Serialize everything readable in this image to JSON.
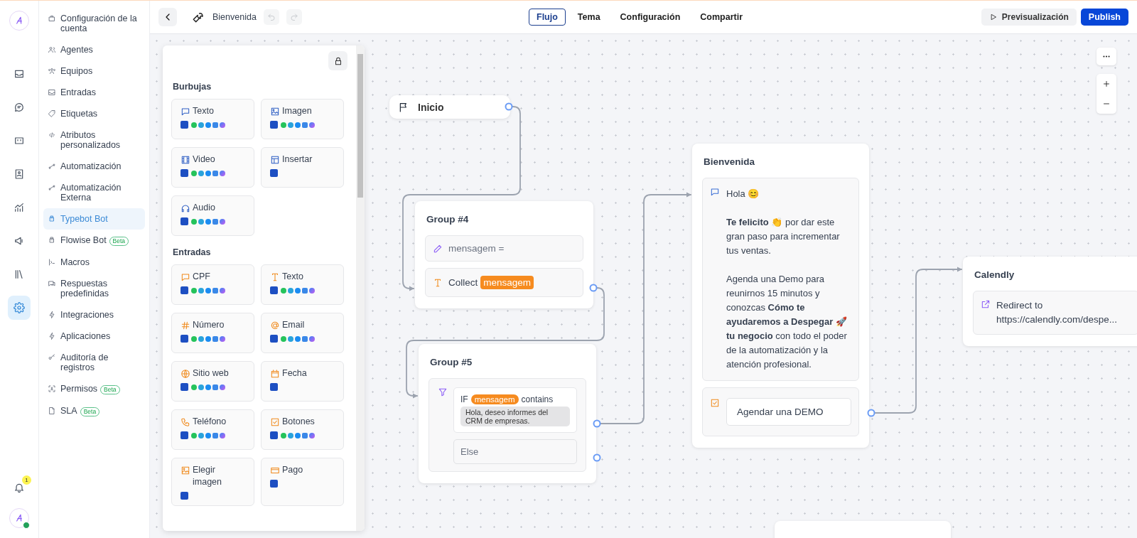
{
  "rail": {
    "items": [
      {
        "kind": "inbox",
        "selected": false
      },
      {
        "kind": "chat",
        "selected": false
      },
      {
        "kind": "widget",
        "selected": false
      },
      {
        "kind": "contacts",
        "selected": false
      },
      {
        "kind": "reports",
        "selected": false
      },
      {
        "kind": "campaigns",
        "selected": false
      },
      {
        "kind": "library",
        "selected": false
      },
      {
        "kind": "settings",
        "selected": true
      }
    ],
    "notifications": {
      "badge": "1"
    },
    "avatar": {
      "online": true
    }
  },
  "sidebar": {
    "items": [
      {
        "kind": "account",
        "label": "Configuración de la cuenta",
        "selected": false
      },
      {
        "kind": "agents",
        "label": "Agentes",
        "selected": false
      },
      {
        "kind": "teams",
        "label": "Equipos",
        "selected": false
      },
      {
        "kind": "inbox",
        "label": "Entradas",
        "selected": false
      },
      {
        "kind": "labels",
        "label": "Etiquetas",
        "selected": false
      },
      {
        "kind": "code",
        "label": "Atributos personalizados",
        "selected": false
      },
      {
        "kind": "automation",
        "label": "Automatización",
        "selected": false
      },
      {
        "kind": "automation",
        "label": "Automatización Externa",
        "selected": false
      },
      {
        "kind": "bot",
        "label": "Typebot Bot",
        "selected": true
      },
      {
        "kind": "bot",
        "label": "Flowise Bot",
        "badge": "Beta",
        "selected": false
      },
      {
        "kind": "macros",
        "label": "Macros",
        "selected": false
      },
      {
        "kind": "canned",
        "label": "Respuestas predefinidas",
        "selected": false
      },
      {
        "kind": "bolt",
        "label": "Integraciones",
        "selected": false
      },
      {
        "kind": "bolt",
        "label": "Aplicaciones",
        "selected": false
      },
      {
        "kind": "key",
        "label": "Auditoría de registros",
        "selected": false
      },
      {
        "kind": "permissions",
        "label": "Permisos",
        "badge": "Beta",
        "selected": false
      },
      {
        "kind": "sla",
        "label": "SLA",
        "badge": "Beta",
        "selected": false
      }
    ]
  },
  "toolbar": {
    "title": "Bienvenida",
    "undo_disabled": true,
    "redo_disabled": true,
    "tabs": [
      {
        "label": "Flujo",
        "selected": true
      },
      {
        "label": "Tema",
        "selected": false
      },
      {
        "label": "Configuración",
        "selected": false
      },
      {
        "label": "Compartir",
        "selected": false
      }
    ],
    "preview": "Previsualización",
    "publish": "Publish"
  },
  "blocks_panel": {
    "locked": false,
    "sections": [
      {
        "kind": "bubbles",
        "title": "Burbujas",
        "items": [
          {
            "kind": "bubble",
            "label": "Texto",
            "all_channels": true
          },
          {
            "kind": "image",
            "label": "Imagen",
            "all_channels": true
          },
          {
            "kind": "video",
            "label": "Video",
            "all_channels": true
          },
          {
            "kind": "embed",
            "label": "Insertar",
            "all_channels": false
          },
          {
            "kind": "audio",
            "label": "Audio",
            "all_channels": true
          }
        ]
      },
      {
        "kind": "inputs",
        "title": "Entradas",
        "items": [
          {
            "kind": "bubble",
            "label": "CPF",
            "all_channels": true
          },
          {
            "kind": "text",
            "label": "Texto",
            "all_channels": true
          },
          {
            "kind": "hash",
            "label": "Número",
            "all_channels": true
          },
          {
            "kind": "at",
            "label": "Email",
            "all_channels": true
          },
          {
            "kind": "globe",
            "label": "Sitio web",
            "all_channels": true
          },
          {
            "kind": "calendar",
            "label": "Fecha",
            "all_channels": false
          },
          {
            "kind": "phone",
            "label": "Teléfono",
            "all_channels": true
          },
          {
            "kind": "checkbox",
            "label": "Botones",
            "all_channels": true
          },
          {
            "kind": "image",
            "label": "Elegir imagen",
            "all_channels": false
          },
          {
            "kind": "card",
            "label": "Pago",
            "all_channels": false
          }
        ]
      }
    ]
  },
  "canvas": {
    "nodes": [
      {
        "kind": "start",
        "title": "Inicio"
      },
      {
        "kind": "group",
        "title": "Group #4",
        "blocks": [
          {
            "kind": "set_variable",
            "text": "mensagem ="
          },
          {
            "kind": "text_input",
            "text": "Collect",
            "variable": "mensagem"
          }
        ]
      },
      {
        "kind": "group",
        "title": "Group #5",
        "blocks": [
          {
            "kind": "condition",
            "keyword": "IF",
            "variable": "mensagem",
            "operator": "contains",
            "value": "Hola, deseo informes del CRM de empresas.",
            "else": "Else"
          }
        ]
      },
      {
        "kind": "group",
        "title": "Bienvenida",
        "blocks": [
          {
            "kind": "text_bubble",
            "paragraphs": [
              "Hola 😊",
              "**Te felicito** 👏 por dar este gran paso para incrementar tus ventas.",
              "Agenda una Demo para reunirnos 15 minutos y conozcas **Cómo te ayudaremos a Despegar 🚀 tu negocio** con todo el poder de la automatización y la atención profesional."
            ]
          },
          {
            "kind": "buttons",
            "items": [
              "Agendar una DEMO"
            ]
          }
        ]
      },
      {
        "kind": "group",
        "title": "Calendly",
        "blocks": [
          {
            "kind": "redirect",
            "text": "Redirect to https://calendly.com/despe..."
          }
        ]
      },
      {
        "kind": "group"
      }
    ]
  }
}
